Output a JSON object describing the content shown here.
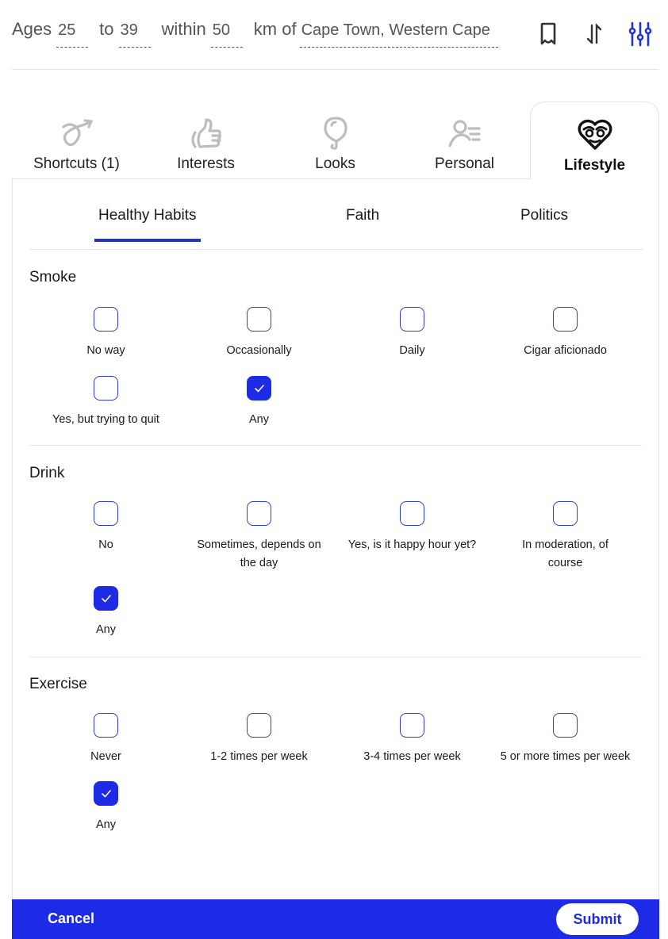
{
  "search_summary": {
    "ages_label": "Ages",
    "age_min": "25",
    "to_label": "to",
    "age_max": "39",
    "within_label": "within",
    "distance": "50",
    "unit_label": "km of",
    "location": "Cape Town, Western Cape"
  },
  "header_icons": [
    {
      "name": "bookmark-icon",
      "color": "#333333"
    },
    {
      "name": "sort-icon",
      "color": "#333333"
    },
    {
      "name": "filter-sliders-icon",
      "color": "#2233cc"
    }
  ],
  "category_tabs": [
    {
      "label": "Shortcuts (1)",
      "icon": "shortcuts-icon",
      "active": false
    },
    {
      "label": "Interests",
      "icon": "thumbs-up-icon",
      "active": false
    },
    {
      "label": "Looks",
      "icon": "balloon-icon",
      "active": false
    },
    {
      "label": "Personal",
      "icon": "person-list-icon",
      "active": false
    },
    {
      "label": "Lifestyle",
      "icon": "heart-face-icon",
      "active": true
    }
  ],
  "sub_tabs": [
    {
      "label": "Healthy Habits",
      "active": true
    },
    {
      "label": "Faith",
      "active": false
    },
    {
      "label": "Politics",
      "active": false
    }
  ],
  "sections": [
    {
      "title": "Smoke",
      "options": [
        {
          "label": "No way",
          "checked": false
        },
        {
          "label": "Occasionally",
          "checked": false
        },
        {
          "label": "Daily",
          "checked": false
        },
        {
          "label": "Cigar aficionado",
          "checked": false
        },
        {
          "label": "Yes, but trying to quit",
          "checked": false
        },
        {
          "label": "Any",
          "checked": true
        }
      ]
    },
    {
      "title": "Drink",
      "options": [
        {
          "label": "No",
          "checked": false
        },
        {
          "label": "Sometimes, depends on the day",
          "checked": false
        },
        {
          "label": "Yes, is it happy hour yet?",
          "checked": false
        },
        {
          "label": "In moderation, of course",
          "checked": false
        },
        {
          "label": "Any",
          "checked": true
        }
      ]
    },
    {
      "title": "Exercise",
      "options": [
        {
          "label": "Never",
          "checked": false
        },
        {
          "label": "1-2 times per week",
          "checked": false
        },
        {
          "label": "3-4 times per week",
          "checked": false
        },
        {
          "label": "5 or more times per week",
          "checked": false
        },
        {
          "label": "Any",
          "checked": true
        }
      ]
    }
  ],
  "footer": {
    "cancel_label": "Cancel",
    "submit_label": "Submit"
  },
  "colors": {
    "accent": "#1d2be6",
    "checkbox_border": "#2f3fc4",
    "inactive_icon": "#bdbdbd"
  }
}
